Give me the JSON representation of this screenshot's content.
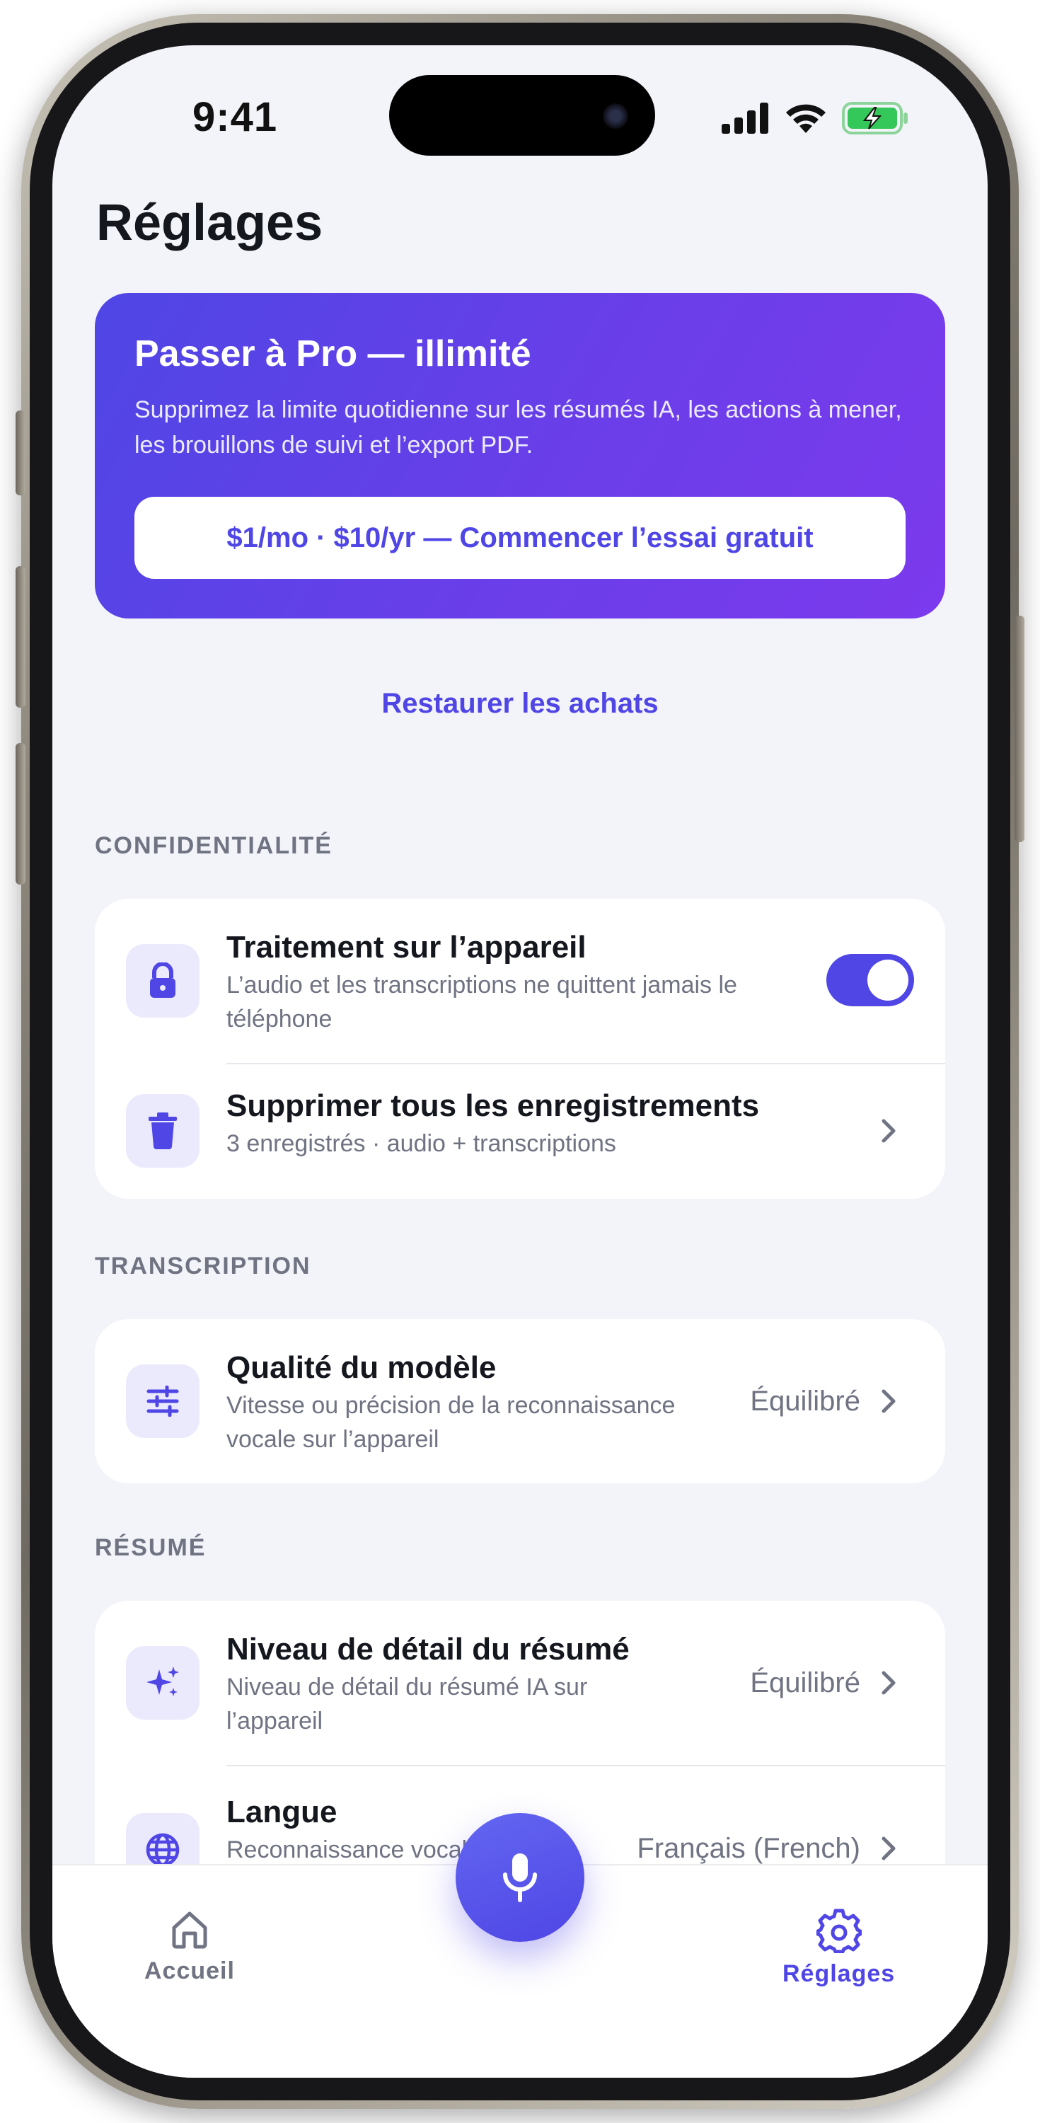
{
  "status_bar": {
    "time": "9:41"
  },
  "header": {
    "title": "Réglages"
  },
  "pro_card": {
    "title": "Passer à Pro — illimité",
    "description": "Supprimez la limite quotidienne sur les résumés IA, les actions à mener, les brouillons de suivi et l’export PDF.",
    "cta_label": "$1/mo · $10/yr — Commencer l’essai gratuit"
  },
  "restore_label": "Restaurer les achats",
  "privacy": {
    "label": "CONFIDENTIALITÉ",
    "on_device": {
      "title": "Traitement sur l’appareil",
      "subtitle": "L’audio et les transcriptions ne quittent jamais le téléphone",
      "enabled": true
    },
    "delete_all": {
      "title": "Supprimer tous les enregistrements",
      "subtitle": "3 enregistrés · audio + transcriptions"
    }
  },
  "transcription": {
    "label": "TRANSCRIPTION",
    "model_quality": {
      "title": "Qualité du modèle",
      "subtitle": "Vitesse ou précision de la reconnaissance vocale sur l’appareil",
      "value": "Équilibré"
    }
  },
  "summary": {
    "label": "RÉSUMÉ",
    "detail_level": {
      "title": "Niveau de détail du résumé",
      "subtitle": "Niveau de détail du résumé IA sur l’appareil",
      "value": "Équilibré"
    },
    "language": {
      "title": "Langue",
      "subtitle": "Reconnaissance vocale sur l’appareil + résumé",
      "value": "Français (French)"
    }
  },
  "tabbar": {
    "home_label": "Accueil",
    "settings_label": "Réglages",
    "active_tab": "settings"
  },
  "colors": {
    "accent": "#4f46e5",
    "accent_purple": "#7c3aed",
    "background": "#f3f4f9",
    "icon_bg": "#ebeafd",
    "muted_text": "#6f7382",
    "inactive_tab": "#6f7382"
  },
  "icons": {
    "privacy_on_device": "lock-icon",
    "privacy_delete": "trash-icon",
    "model_quality": "sliders-icon",
    "detail_level": "sparkles-icon",
    "language": "globe-icon",
    "record": "microphone-icon",
    "home": "home-icon",
    "settings": "gear-icon"
  }
}
